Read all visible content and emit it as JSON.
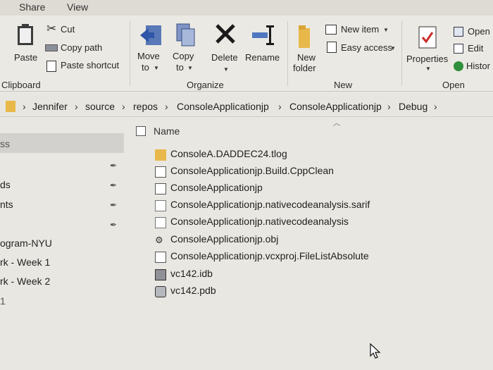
{
  "ribbon_tabs": {
    "share": "Share",
    "view": "View"
  },
  "clipboard": {
    "paste": "Paste",
    "cut": "Cut",
    "copy_path": "Copy path",
    "paste_shortcut": "Paste shortcut",
    "group": "Clipboard"
  },
  "organize": {
    "move_to": "Move",
    "move_to_2": "to",
    "copy_to": "Copy",
    "copy_to_2": "to",
    "delete": "Delete",
    "rename": "Rename",
    "group": "Organize"
  },
  "new": {
    "new_item": "New item",
    "easy_access": "Easy access",
    "new_folder": "New",
    "new_folder_2": "folder",
    "group": "New"
  },
  "open": {
    "properties": "Properties",
    "open": "Open",
    "edit": "Edit",
    "history": "Histor",
    "group": "Open"
  },
  "breadcrumb": [
    "Jennifer",
    "source",
    "repos",
    "ConsoleApplicationjp",
    "ConsoleApplicationjp",
    "Debug"
  ],
  "column_header": "Name",
  "nav_items": [
    "ss",
    "ds",
    "nts",
    "ogram-NYU",
    "rk - Week 1",
    "rk - Week 2",
    "1"
  ],
  "files": [
    {
      "name": "ConsoleA.DADDEC24.tlog",
      "icon": "folder-icon"
    },
    {
      "name": "ConsoleApplicationjp.Build.CppClean",
      "icon": "text-file-icon"
    },
    {
      "name": "ConsoleApplicationjp",
      "icon": "text-file-icon"
    },
    {
      "name": "ConsoleApplicationjp.nativecodeanalysis.sarif",
      "icon": "blank-file-icon"
    },
    {
      "name": "ConsoleApplicationjp.nativecodeanalysis",
      "icon": "blank-file-icon"
    },
    {
      "name": "ConsoleApplicationjp.obj",
      "icon": "obj-file-icon"
    },
    {
      "name": "ConsoleApplicationjp.vcxproj.FileListAbsolute",
      "icon": "text-file-icon"
    },
    {
      "name": "vc142.idb",
      "icon": "idb-file-icon"
    },
    {
      "name": "vc142.pdb",
      "icon": "pdb-file-icon"
    }
  ],
  "colors": {
    "folder": "#e8b84a",
    "delete_x": "#1a1a1a",
    "accent_blue": "#3b6fc4",
    "properties_check": "#cc2b2b"
  }
}
